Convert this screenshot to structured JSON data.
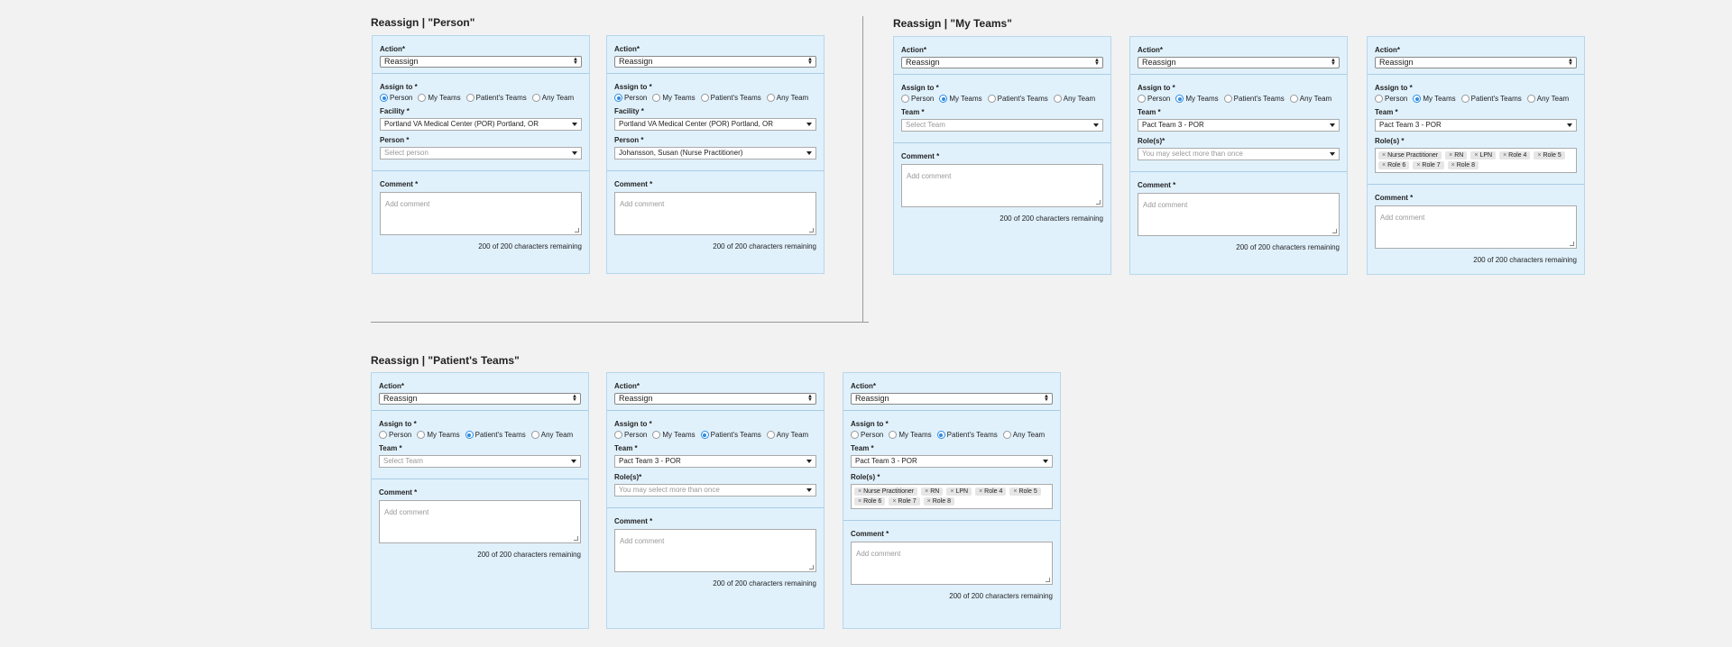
{
  "sections": [
    {
      "title": "Reassign |  \"Person\""
    },
    {
      "title": "Reassign | \"My Teams\""
    },
    {
      "title": "Reassign | \"Patient's Teams\""
    }
  ],
  "labels": {
    "action": "Action*",
    "assign_to": "Assign to *",
    "facility": "Facility *",
    "person": "Person *",
    "team": "Team *",
    "roles": "Role(s)*",
    "roles_star": "Role(s) *",
    "comment": "Comment *"
  },
  "action_value": "Reassign",
  "radio_options": [
    "Person",
    "My Teams",
    "Patient's Teams",
    "Any Team"
  ],
  "values": {
    "facility": "Portland VA Medical Center (POR) Portland, OR",
    "person_placeholder": "Select person",
    "person_selected": "Johansson, Susan (Nurse Practitioner)",
    "team_placeholder": "Select Team",
    "team_selected": "Pact Team 3 - POR",
    "roles_placeholder": "You may select more than once",
    "comment_placeholder": "Add comment",
    "char_count": "200 of 200 characters remaining"
  },
  "role_tags": [
    "Nurse Practitioner",
    "RN",
    "LPN",
    "Role 4",
    "Role 5",
    "Role 6",
    "Role 7",
    "Role 8"
  ],
  "icons": {
    "remove": "×"
  }
}
